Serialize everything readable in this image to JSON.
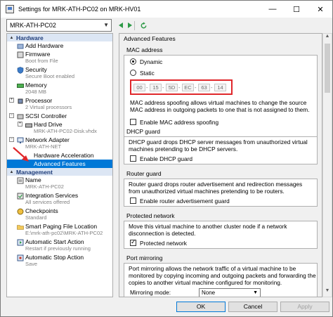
{
  "window": {
    "title": "Settings for MRK-ATH-PC02 on MRK-HV01",
    "minimize_glyph": "—",
    "maximize_glyph": "☐",
    "close_glyph": "✕"
  },
  "toolbar": {
    "vm_selected": "MRK-ATH-PC02",
    "back_icon": "arrow-left-icon",
    "forward_icon": "arrow-right-icon",
    "refresh_icon": "refresh-icon"
  },
  "sidebar": {
    "hardware_heading": "Hardware",
    "management_heading": "Management",
    "hardware_items": [
      {
        "label": "Add Hardware",
        "sub": ""
      },
      {
        "label": "Firmware",
        "sub": "Boot from File"
      },
      {
        "label": "Security",
        "sub": "Secure Boot enabled"
      },
      {
        "label": "Memory",
        "sub": "2048 MB"
      },
      {
        "label": "Processor",
        "sub": "2 Virtual processors"
      },
      {
        "label": "SCSI Controller",
        "sub": ""
      },
      {
        "label": "Hard Drive",
        "sub": "MRK-ATH-PC02-Disk.vhdx"
      },
      {
        "label": "Network Adapter",
        "sub": "MRK-ATH-NET"
      },
      {
        "label": "Hardware Acceleration",
        "sub": ""
      },
      {
        "label": "Advanced Features",
        "sub": ""
      }
    ],
    "management_items": [
      {
        "label": "Name",
        "sub": "MRK-ATH-PC02"
      },
      {
        "label": "Integration Services",
        "sub": "All services offered"
      },
      {
        "label": "Checkpoints",
        "sub": "Standard"
      },
      {
        "label": "Smart Paging File Location",
        "sub": "E:\\mrk-ath-pc02\\MRK-ATH-PC02"
      },
      {
        "label": "Automatic Start Action",
        "sub": "Restart if previously running"
      },
      {
        "label": "Automatic Stop Action",
        "sub": "Save"
      }
    ]
  },
  "content": {
    "advanced_title": "Advanced Features",
    "mac": {
      "title": "MAC address",
      "dynamic_label": "Dynamic",
      "static_label": "Static",
      "selected": "Dynamic",
      "segments": [
        "00",
        "15",
        "5D",
        "EC",
        "63",
        "14"
      ],
      "spoofing_desc": "MAC address spoofing allows virtual machines to change the source MAC address in outgoing packets to one that is not assigned to them.",
      "spoofing_checkbox": "Enable MAC address spoofing",
      "spoofing_checked": false
    },
    "dhcp": {
      "title": "DHCP guard",
      "desc": "DHCP guard drops DHCP server messages from unauthorized virtual machines pretending to be DHCP servers.",
      "checkbox": "Enable DHCP guard",
      "checked": false
    },
    "router": {
      "title": "Router guard",
      "desc": "Router guard drops router advertisement and redirection messages from unauthorized virtual machines pretending to be routers.",
      "checkbox": "Enable router advertisement guard",
      "checked": false
    },
    "protected": {
      "title": "Protected network",
      "desc": "Move this virtual machine to another cluster node if a network disconnection is detected.",
      "checkbox": "Protected network",
      "checked": true
    },
    "mirroring": {
      "title": "Port mirroring",
      "desc": "Port mirroring allows the network traffic of a virtual machine to be monitored by copying incoming and outgoing packets and forwarding the copies to another virtual machine configured for monitoring.",
      "mode_label": "Mirroring mode:",
      "mode_value": "None"
    }
  },
  "buttons": {
    "ok": "OK",
    "cancel": "Cancel",
    "apply": "Apply"
  },
  "colors": {
    "selection": "#0078d7",
    "highlight_box": "#e0272b",
    "section_heading": "#1f3d7a"
  }
}
